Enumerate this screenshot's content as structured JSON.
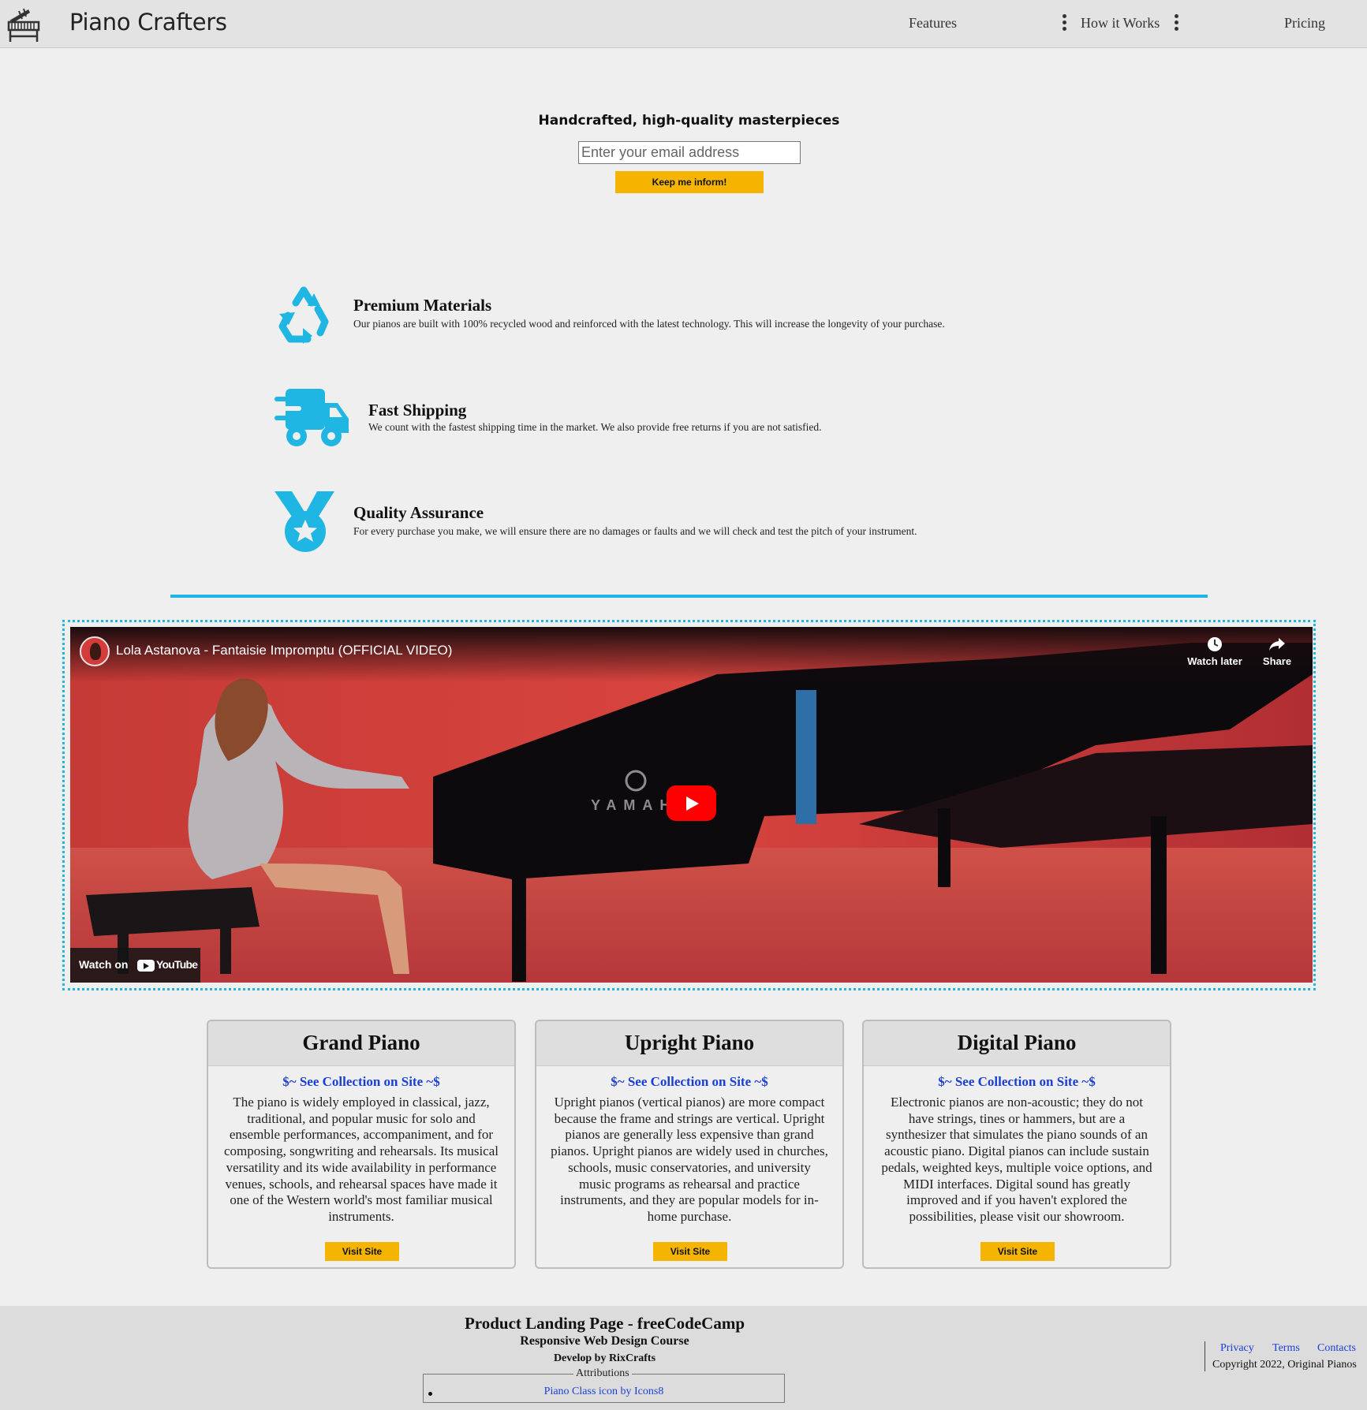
{
  "header": {
    "brand": "Piano Crafters",
    "nav": [
      "Features",
      "How it Works",
      "Pricing"
    ],
    "logo_icon": "grand-piano-icon"
  },
  "hero": {
    "title": "Handcrafted, high-quality masterpieces",
    "email_placeholder": "Enter your email address",
    "button": "Keep me inform!"
  },
  "features": [
    {
      "title": "Premium Materials",
      "text": "Our pianos are built with 100% recycled wood and reinforced with the latest technology. This will increase the longevity of your purchase.",
      "icon": "recycle-icon"
    },
    {
      "title": "Fast Shipping",
      "text": "We count with the fastest shipping time in the market. We also provide free returns if you are not satisfied.",
      "icon": "truck-icon"
    },
    {
      "title": "Quality Assurance",
      "text": "For every purchase you make, we will ensure there are no damages or faults and we will check and test the pitch of your instrument.",
      "icon": "medal-icon"
    }
  ],
  "video": {
    "title": "Lola Astanova - Fantaisie Impromptu (OFFICIAL VIDEO)",
    "watch_later": "Watch later",
    "share": "Share",
    "watch_on": "Watch on",
    "youtube": "YouTube",
    "piano_brand": "YAMAHA"
  },
  "cards": [
    {
      "title": "Grand Piano",
      "link": "$~ See Collection on Site ~$",
      "text": "The piano is widely employed in classical, jazz, traditional, and popular music for solo and ensemble performances, accompaniment, and for composing, songwriting and rehearsals. Its musical versatility and its wide availability in performance venues, schools, and rehearsal spaces have made it one of the Western world's most familiar musical instruments.",
      "button": "Visit Site"
    },
    {
      "title": "Upright Piano",
      "link": "$~ See Collection on Site ~$",
      "text": "Upright pianos (vertical pianos) are more compact because the frame and strings are vertical. Upright pianos are generally less expensive than grand pianos. Upright pianos are widely used in churches, schools, music conservatories, and university music programs as rehearsal and practice instruments, and they are popular models for in-home purchase.",
      "button": "Visit Site"
    },
    {
      "title": "Digital Piano",
      "link": "$~ See Collection on Site ~$",
      "text": "Electronic pianos are non-acoustic; they do not have strings, tines or hammers, but are a synthesizer that simulates the piano sounds of an acoustic piano. Digital pianos can include sustain pedals, weighted keys, multiple voice options, and MIDI interfaces. Digital sound has greatly improved and if you haven't explored the possibilities, please visit our showroom.",
      "button": "Visit Site"
    }
  ],
  "footer": {
    "title": "Product Landing Page - freeCodeCamp",
    "subtitle": "Responsive Web Design Course",
    "developer": "Develop by RixCrafts",
    "attributions_legend": "Attributions",
    "attribution_link": "Piano Class icon by Icons8",
    "links": [
      "Privacy",
      "Terms",
      "Contacts"
    ],
    "copyright": "Copyright 2022, Original Pianos"
  },
  "colors": {
    "accent": "#1fb6e3",
    "button": "#f4b400",
    "link": "#1a3fd6"
  }
}
